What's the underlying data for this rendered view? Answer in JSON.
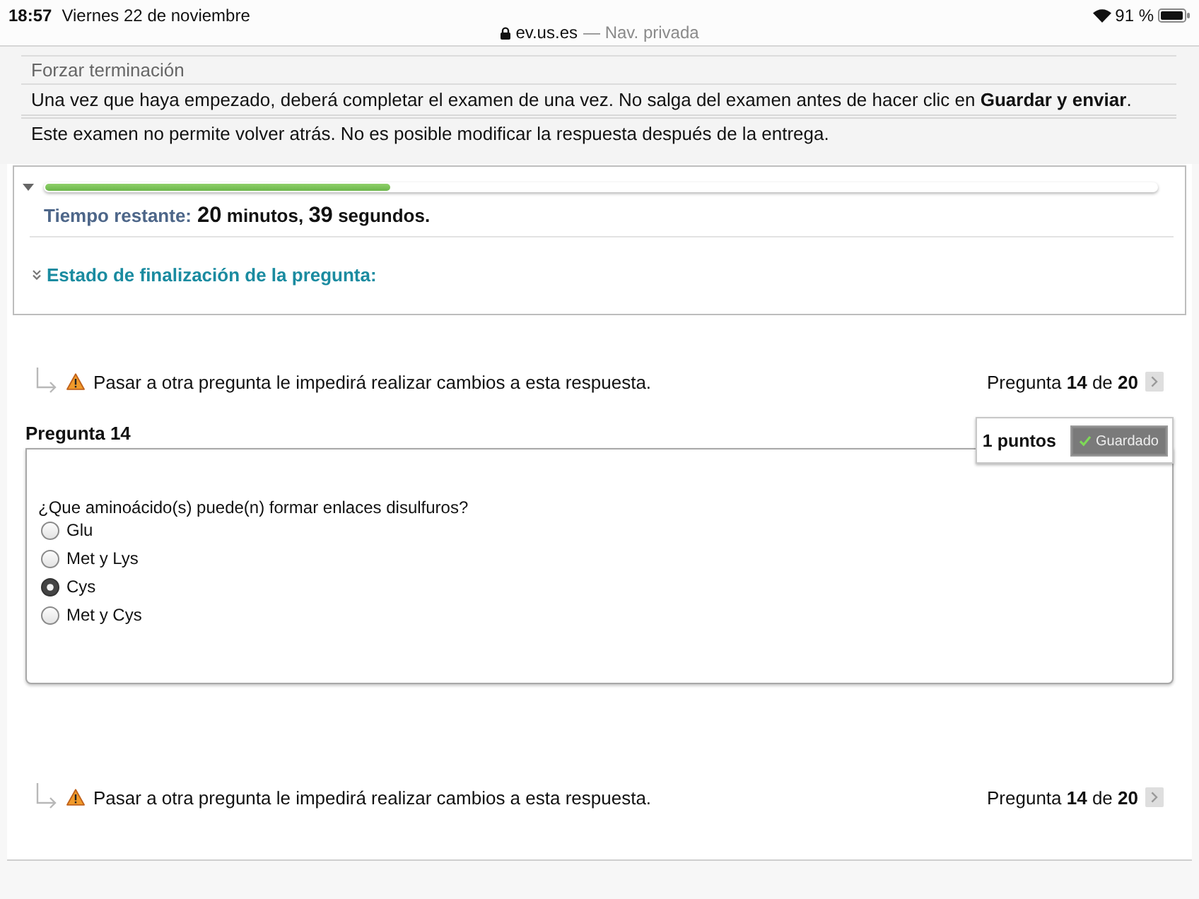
{
  "status_bar": {
    "time": "18:57",
    "date": "Viernes 22 de noviembre",
    "url": "ev.us.es",
    "browsing_mode": "— Nav. privada",
    "battery": "91 %"
  },
  "exam_info": [
    {
      "kind": "setting",
      "text": "Forzar terminación"
    },
    {
      "kind": "note",
      "text": "Una vez que haya empezado, deberá completar el examen de una vez. No salga del examen antes de hacer clic en **Guardar y enviar**."
    },
    {
      "kind": "note",
      "text": "Este examen no permite volver atrás. No es posible modificar la respuesta después de la entrega."
    }
  ],
  "timer": {
    "level": 0.31,
    "label": "Tiempo restante:",
    "minutes": "20",
    "minutes_unit": "minutos,",
    "seconds": "39",
    "seconds_unit": "segundos."
  },
  "completion_status": {
    "label": "Estado de finalización de la pregunta:"
  },
  "navigation_top": {
    "warning": "Pasar a otra pregunta le impedirá realizar cambios a esta respuesta.",
    "position": "Pregunta **14** de **20**"
  },
  "question": {
    "title": "Pregunta 14",
    "points": "1 puntos",
    "status": "Guardado",
    "text": "¿Que aminoácido(s) puede(n) formar enlaces disulfuros?",
    "options": [
      {
        "label": "Glu",
        "selected": false
      },
      {
        "label": "Met y Lys",
        "selected": false
      },
      {
        "label": "Cys",
        "selected": true
      },
      {
        "label": "Met y Cys",
        "selected": false
      }
    ]
  },
  "navigation_bottom": {
    "warning": "Pasar a otra pregunta le impedirá realizar cambios a esta respuesta.",
    "position": "Pregunta **14** de **20**"
  }
}
